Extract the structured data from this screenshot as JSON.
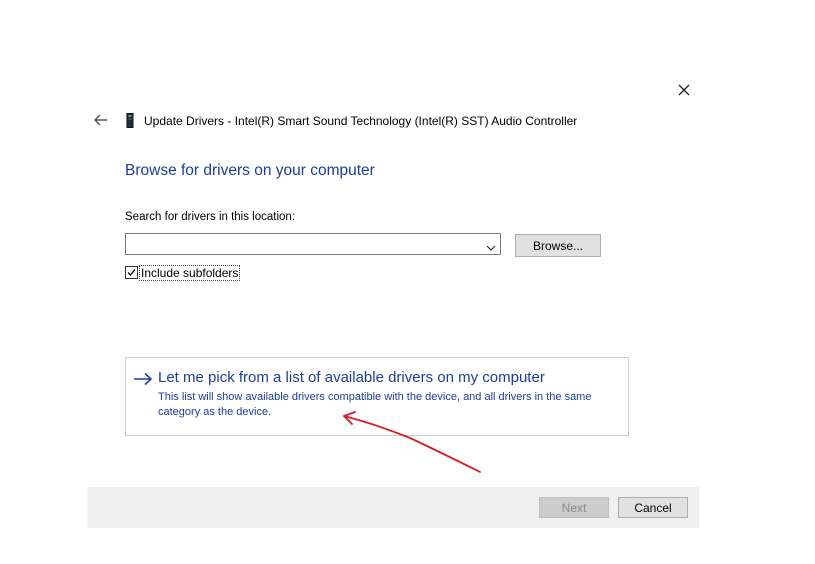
{
  "window": {
    "title": "Update Drivers - Intel(R) Smart Sound Technology (Intel(R) SST) Audio Controller"
  },
  "icons": {
    "close": "close-icon",
    "back": "back-arrow-icon",
    "device": "device-icon",
    "option_arrow": "right-arrow-icon",
    "combo": "chevron-down-icon",
    "checkbox": "checkmark-icon"
  },
  "main": {
    "heading": "Browse for drivers on your computer",
    "search_label": "Search for drivers in this location:",
    "path_value": "",
    "browse_label": "Browse...",
    "include_subfolders_label": "Include subfolders",
    "include_subfolders_checked": true
  },
  "option": {
    "title": "Let me pick from a list of available drivers on my computer",
    "description": "This list will show available drivers compatible with the device, and all drivers in the same category as the device."
  },
  "footer": {
    "next_label": "Next",
    "cancel_label": "Cancel",
    "next_enabled": false
  },
  "colors": {
    "link_blue": "#1a3e9b",
    "annotation_red": "#d0202a",
    "footer_bg": "#f0f0f0"
  }
}
